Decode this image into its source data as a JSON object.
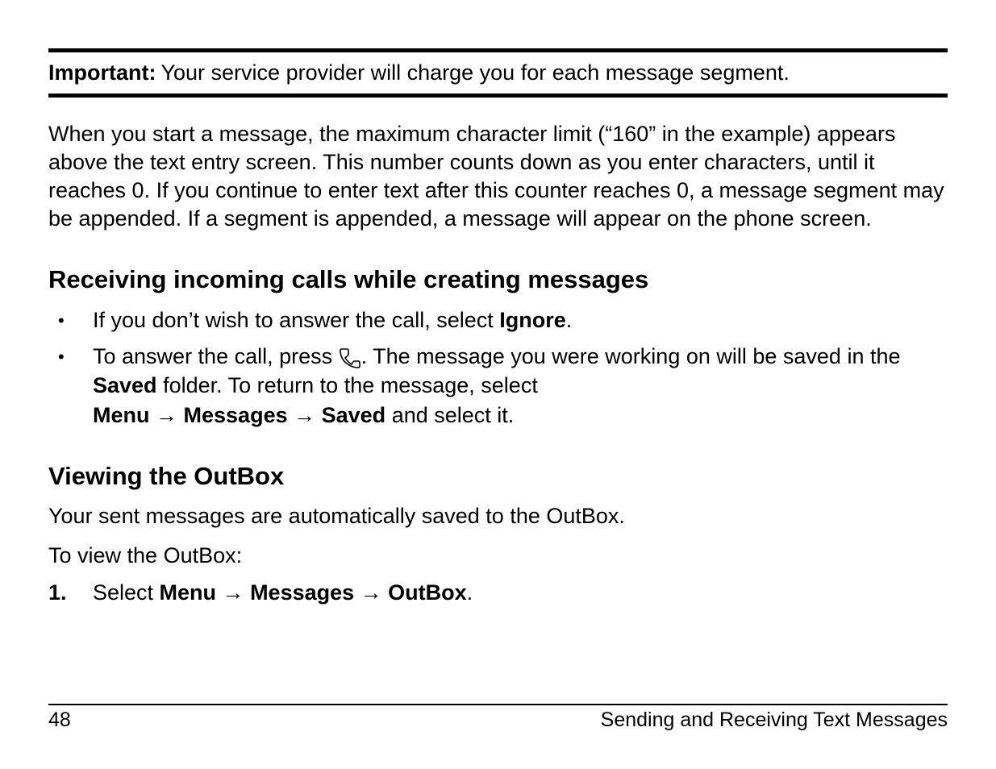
{
  "important": {
    "label": "Important:",
    "text": "Your service provider will charge you for each message segment."
  },
  "para1": "When you start a message, the maximum character limit (“160” in the example) appears above the text entry screen. This number counts down as you enter characters, until it reaches 0. If you continue to enter text after this counter reaches 0, a message segment may be appended. If a segment is appended, a message will appear on the phone screen.",
  "heading1": "Receiving incoming calls while creating messages",
  "bullets": {
    "b1": {
      "pre": "If you don’t wish to answer the call, select ",
      "bold": "Ignore",
      "post": "."
    },
    "b2": {
      "line1_pre": "To answer the call, press ",
      "line1_post": ". The message you were working on will be saved in the ",
      "saved": "Saved",
      "line1_post2": " folder. To return to the message, select ",
      "menu": "Menu",
      "arrow": " → ",
      "messages": "Messages",
      "saved2": "Saved",
      "tail": " and select it."
    }
  },
  "heading2": "Viewing the OutBox",
  "para2": "Your sent messages are automatically saved to the OutBox.",
  "para3": "To view the OutBox:",
  "step1": {
    "num": "1.",
    "pre": "Select ",
    "menu": "Menu",
    "arrow": " → ",
    "messages": "Messages",
    "outbox": "OutBox",
    "post": "."
  },
  "footer": {
    "page": "48",
    "chapter": "Sending and Receiving Text Messages"
  }
}
